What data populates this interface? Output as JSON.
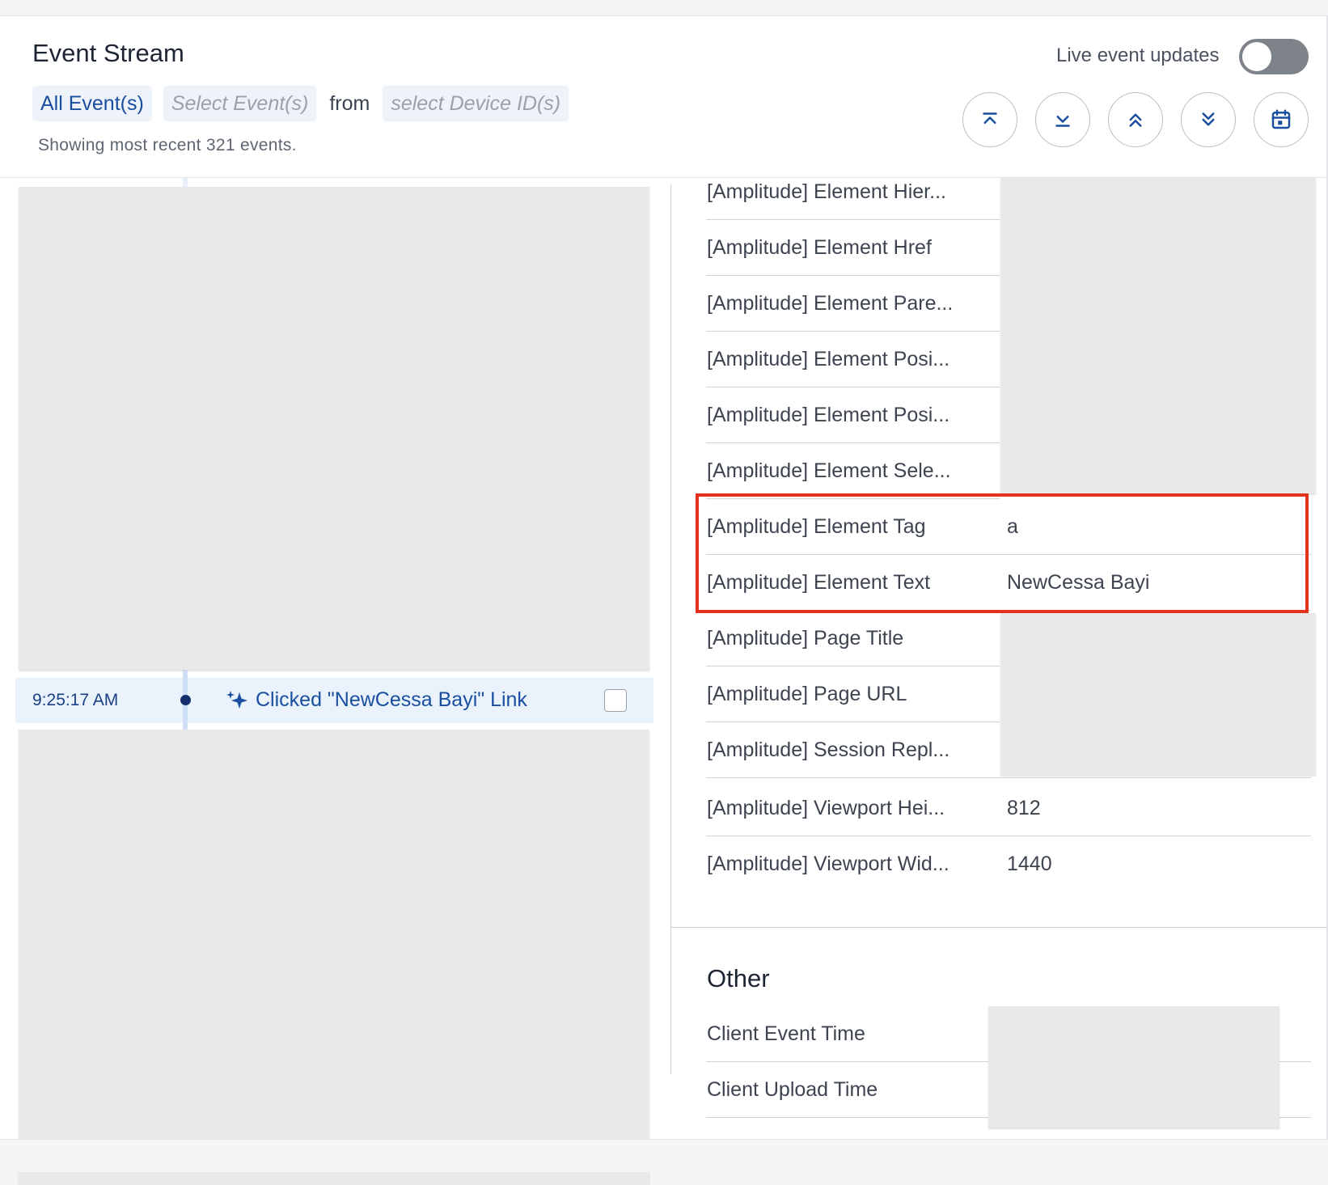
{
  "header": {
    "title": "Event Stream",
    "filters": {
      "all_events": "All Event(s)",
      "select_events_placeholder": "Select Event(s)",
      "from_word": "from",
      "select_device_placeholder": "select Device ID(s)"
    },
    "count_text": "Showing most recent 321 events.",
    "live_updates_label": "Live event updates",
    "live_updates_enabled": false,
    "toolbar_icons": [
      "jump-to-top-icon",
      "jump-to-bottom-icon",
      "previous-event-icon",
      "next-event-icon",
      "calendar-icon"
    ]
  },
  "event": {
    "time": "9:25:17 AM",
    "label": "Clicked \"NewCessa Bayi\" Link",
    "icon": "sparkle-icon",
    "selected": false
  },
  "properties": [
    {
      "key": "[Amplitude] Element Hier...",
      "value": ""
    },
    {
      "key": "[Amplitude] Element Href",
      "value": ""
    },
    {
      "key": "[Amplitude] Element Pare...",
      "value": ""
    },
    {
      "key": "[Amplitude] Element Posi...",
      "value": ""
    },
    {
      "key": "[Amplitude] Element Posi...",
      "value": ""
    },
    {
      "key": "[Amplitude] Element Sele...",
      "value": ""
    },
    {
      "key": "[Amplitude] Element Tag",
      "value": "a"
    },
    {
      "key": "[Amplitude] Element Text",
      "value": "NewCessa Bayi"
    },
    {
      "key": "[Amplitude] Page Title",
      "value": ""
    },
    {
      "key": "[Amplitude] Page URL",
      "value": ""
    },
    {
      "key": "[Amplitude] Session Repl...",
      "value": ""
    },
    {
      "key": "[Amplitude] Viewport Hei...",
      "value": "812"
    },
    {
      "key": "[Amplitude] Viewport Wid...",
      "value": "1440"
    }
  ],
  "other_section": {
    "title": "Other",
    "properties": [
      {
        "key": "Client Event Time",
        "value": ""
      },
      {
        "key": "Client Upload Time",
        "value": ""
      }
    ]
  },
  "colors": {
    "accent": "#1a4fa0",
    "highlight_border": "#e3331f",
    "redaction_gray": "#e9e9e9"
  }
}
